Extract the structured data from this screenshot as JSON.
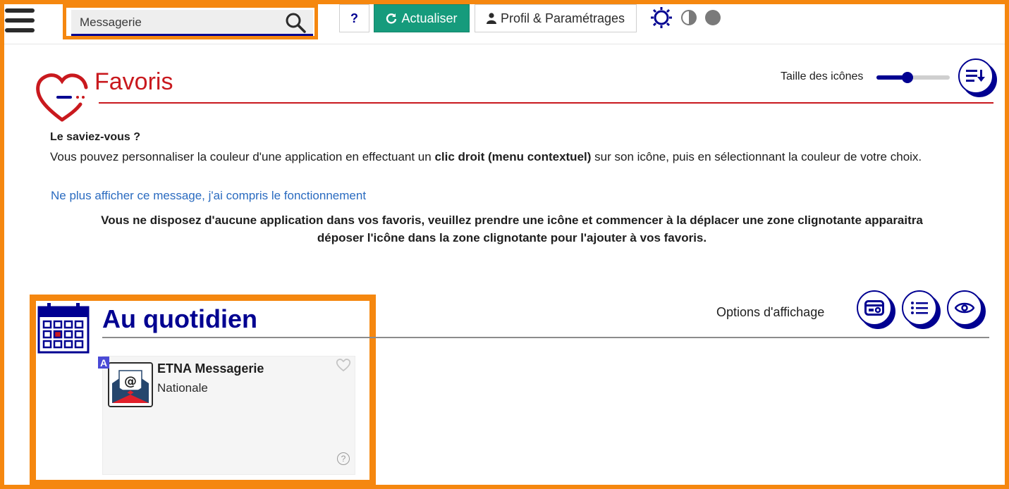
{
  "header": {
    "search": {
      "value": "Messagerie",
      "icon": "search-icon"
    },
    "help_label": "?",
    "refresh_label": "Actualiser",
    "profile_label": "Profil & Paramétrages",
    "colors": {
      "accent": "#000091",
      "refresh": "#169b7c",
      "highlight": "#f5870f"
    }
  },
  "favoris": {
    "title": "Favoris",
    "icon_size_label": "Taille des icônes",
    "icon_size_level": 0.42,
    "tip_title": "Le saviez-vous ?",
    "tip_text_before": "Vous pouvez personnaliser la couleur d'une application en effectuant un ",
    "tip_text_bold": "clic droit (menu contextuel)",
    "tip_text_after": " sur son icône, puis en sélectionnant la couleur de votre choix.",
    "dismiss_link": "Ne plus afficher ce message, j'ai compris le fonctionnement",
    "empty_line1": "Vous ne disposez d'aucune application dans vos favoris, veuillez prendre une icône et commencer à la déplacer une zone clignotante apparaitra",
    "empty_line2": "déposer l'icône dans la zone clignotante pour l'ajouter à vos favoris.",
    "title_color": "#c9191e"
  },
  "quotidien": {
    "title": "Au quotidien",
    "options_label": "Options d'affichage",
    "apps": [
      {
        "badge": "A",
        "name": "ETNA Messagerie",
        "scope": "Nationale",
        "help": "?"
      }
    ]
  }
}
